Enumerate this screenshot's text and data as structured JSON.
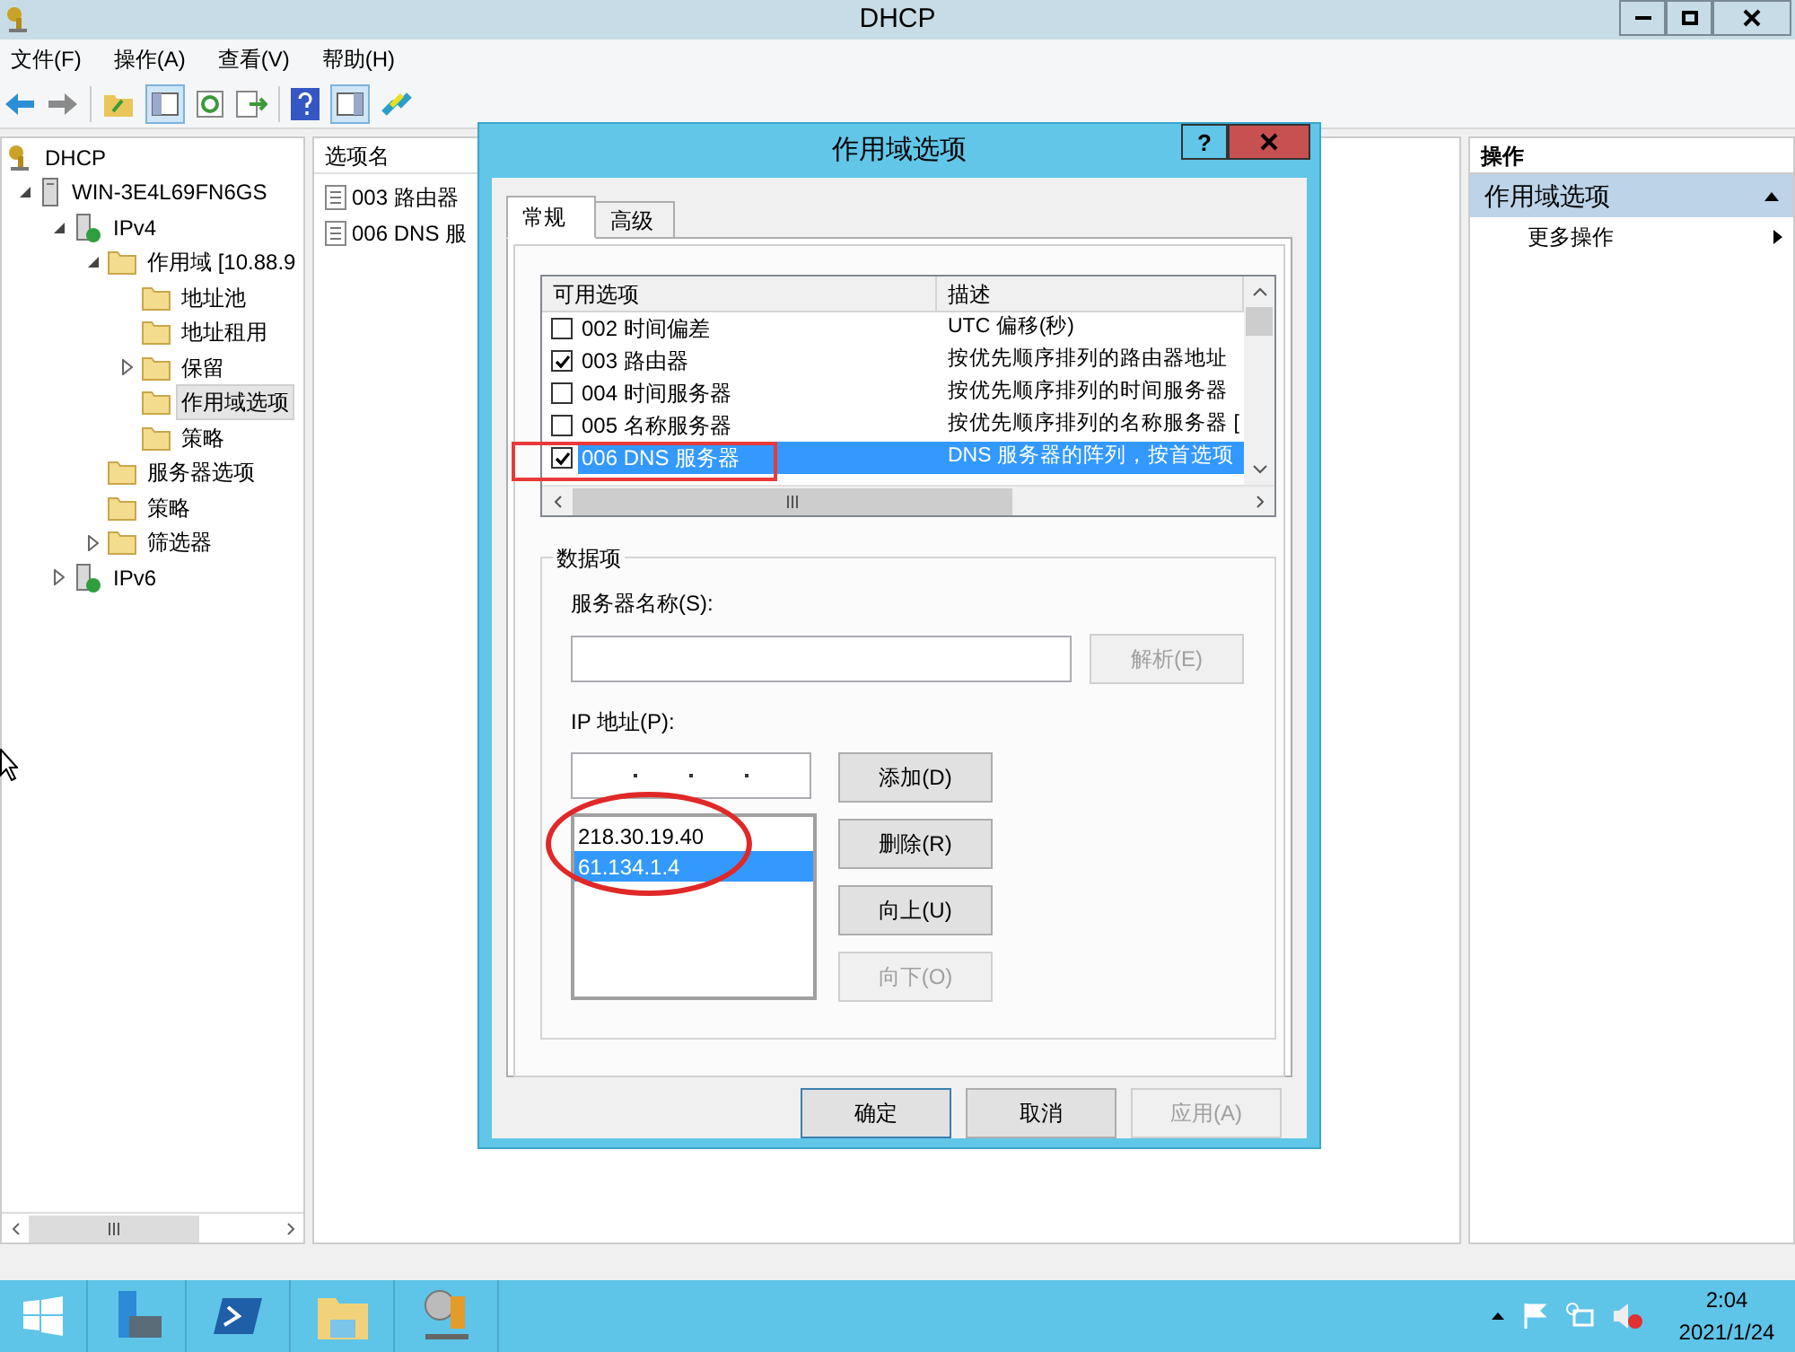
{
  "window": {
    "title": "DHCP"
  },
  "menu": [
    "文件(F)",
    "操作(A)",
    "查看(V)",
    "帮助(H)"
  ],
  "tree": [
    {
      "label": "DHCP",
      "kind": "root",
      "expandable": false,
      "selected": false,
      "children": [
        {
          "label": "WIN-3E4L69FN6GS",
          "kind": "server",
          "expandable": true,
          "expanded": true,
          "selected": false,
          "children": [
            {
              "label": "IPv4",
              "kind": "protocol",
              "expandable": true,
              "expanded": true,
              "selected": false,
              "children": [
                {
                  "label": "作用域 [10.88.9",
                  "kind": "folder",
                  "expandable": true,
                  "expanded": true,
                  "selected": false,
                  "children": [
                    {
                      "label": "地址池",
                      "kind": "folder",
                      "expandable": false,
                      "selected": false
                    },
                    {
                      "label": "地址租用",
                      "kind": "folder",
                      "expandable": false,
                      "selected": false
                    },
                    {
                      "label": "保留",
                      "kind": "folder",
                      "expandable": true,
                      "expanded": false,
                      "selected": false
                    },
                    {
                      "label": "作用域选项",
                      "kind": "folder",
                      "expandable": false,
                      "selected": true
                    },
                    {
                      "label": "策略",
                      "kind": "folder",
                      "expandable": false,
                      "selected": false
                    }
                  ]
                },
                {
                  "label": "服务器选项",
                  "kind": "folder",
                  "expandable": false,
                  "selected": false
                },
                {
                  "label": "策略",
                  "kind": "folder",
                  "expandable": false,
                  "selected": false
                },
                {
                  "label": "筛选器",
                  "kind": "folder",
                  "expandable": true,
                  "expanded": false,
                  "selected": false
                }
              ]
            },
            {
              "label": "IPv6",
              "kind": "protocol",
              "expandable": true,
              "expanded": false,
              "selected": false
            }
          ]
        }
      ]
    }
  ],
  "list": {
    "column": "选项名",
    "items": [
      "003 路由器",
      "006 DNS 服"
    ]
  },
  "actions": {
    "title": "操作",
    "section": "作用域选项",
    "items": [
      "更多操作"
    ]
  },
  "dialog": {
    "title": "作用域选项",
    "help": "?",
    "tabs": [
      {
        "label": "常规",
        "selected": true
      },
      {
        "label": "高级",
        "selected": false
      }
    ],
    "options": {
      "columns": [
        "可用选项",
        "描述"
      ],
      "rows": [
        {
          "name": "002 时间偏差",
          "description": "UTC 偏移(秒)",
          "checked": false,
          "selected": false
        },
        {
          "name": "003 路由器",
          "description": "按优先顺序排列的路由器地址",
          "checked": true,
          "selected": false
        },
        {
          "name": "004 时间服务器",
          "description": "按优先顺序排列的时间服务器",
          "checked": false,
          "selected": false
        },
        {
          "name": "005 名称服务器",
          "description": "按优先顺序排列的名称服务器 [",
          "checked": false,
          "selected": false
        },
        {
          "name": "006 DNS 服务器",
          "description": "DNS 服务器的阵列，按首选项",
          "checked": true,
          "selected": true
        }
      ]
    },
    "group": "数据项",
    "server_label": "服务器名称(S):",
    "resolve": {
      "label": "解析(E)",
      "disabled": true
    },
    "ip_label": "IP 地址(P):",
    "ips": [
      {
        "text": "218.30.19.40",
        "selected": false
      },
      {
        "text": "61.134.1.4",
        "selected": true
      }
    ],
    "side_buttons": [
      {
        "label": "添加(D)",
        "disabled": false
      },
      {
        "label": "删除(R)",
        "disabled": false
      },
      {
        "label": "向上(U)",
        "disabled": false
      },
      {
        "label": "向下(O)",
        "disabled": true
      }
    ],
    "footer": [
      {
        "label": "确定",
        "disabled": false,
        "default": true
      },
      {
        "label": "取消",
        "disabled": false,
        "default": false
      },
      {
        "label": "应用(A)",
        "disabled": true,
        "default": false
      }
    ]
  },
  "clock": {
    "time": "2:04",
    "date": "2021/1/24"
  }
}
